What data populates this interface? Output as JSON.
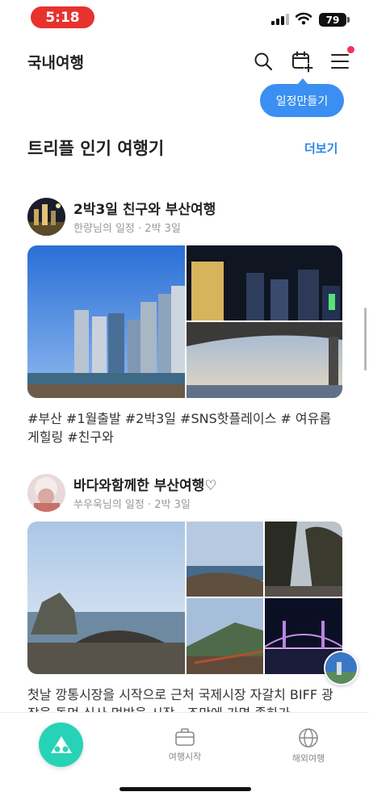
{
  "status": {
    "time": "5:18",
    "battery": "79"
  },
  "header": {
    "title": "국내여행",
    "tooltip": "일정만들기"
  },
  "section": {
    "title": "트리플 인기 여행기",
    "more": "더보기"
  },
  "posts": [
    {
      "title": "2박3일 친구와 부산여행",
      "meta": "한량님의 일정 · 2박 3일",
      "tags": "#부산 #1월출발 #2박3일 #SNS핫플레이스 # 여유롭게힐링 #친구와"
    },
    {
      "title": "바다와함께한 부산여행♡",
      "meta": "쑤우욱님의 일정 · 2박 3일",
      "tags": "첫날 깡통시장을 시작으로 근처 국제시장 자갈치 BIFF 광장을 돌며 식사 먹방을 시작...조만에 가면 좋하가"
    }
  ],
  "nav": {
    "items": [
      {
        "label": "여행시작"
      },
      {
        "label": "해외여행"
      }
    ]
  },
  "colors": {
    "accent": "#2f86ea",
    "fab": "#27d3b7",
    "tooltip": "#3b8ff2",
    "badge": "#f0335d"
  },
  "icons": [
    "search-icon",
    "calendar-add-icon",
    "menu-icon",
    "suitcase-icon",
    "globe-icon",
    "triple-logo-icon"
  ]
}
